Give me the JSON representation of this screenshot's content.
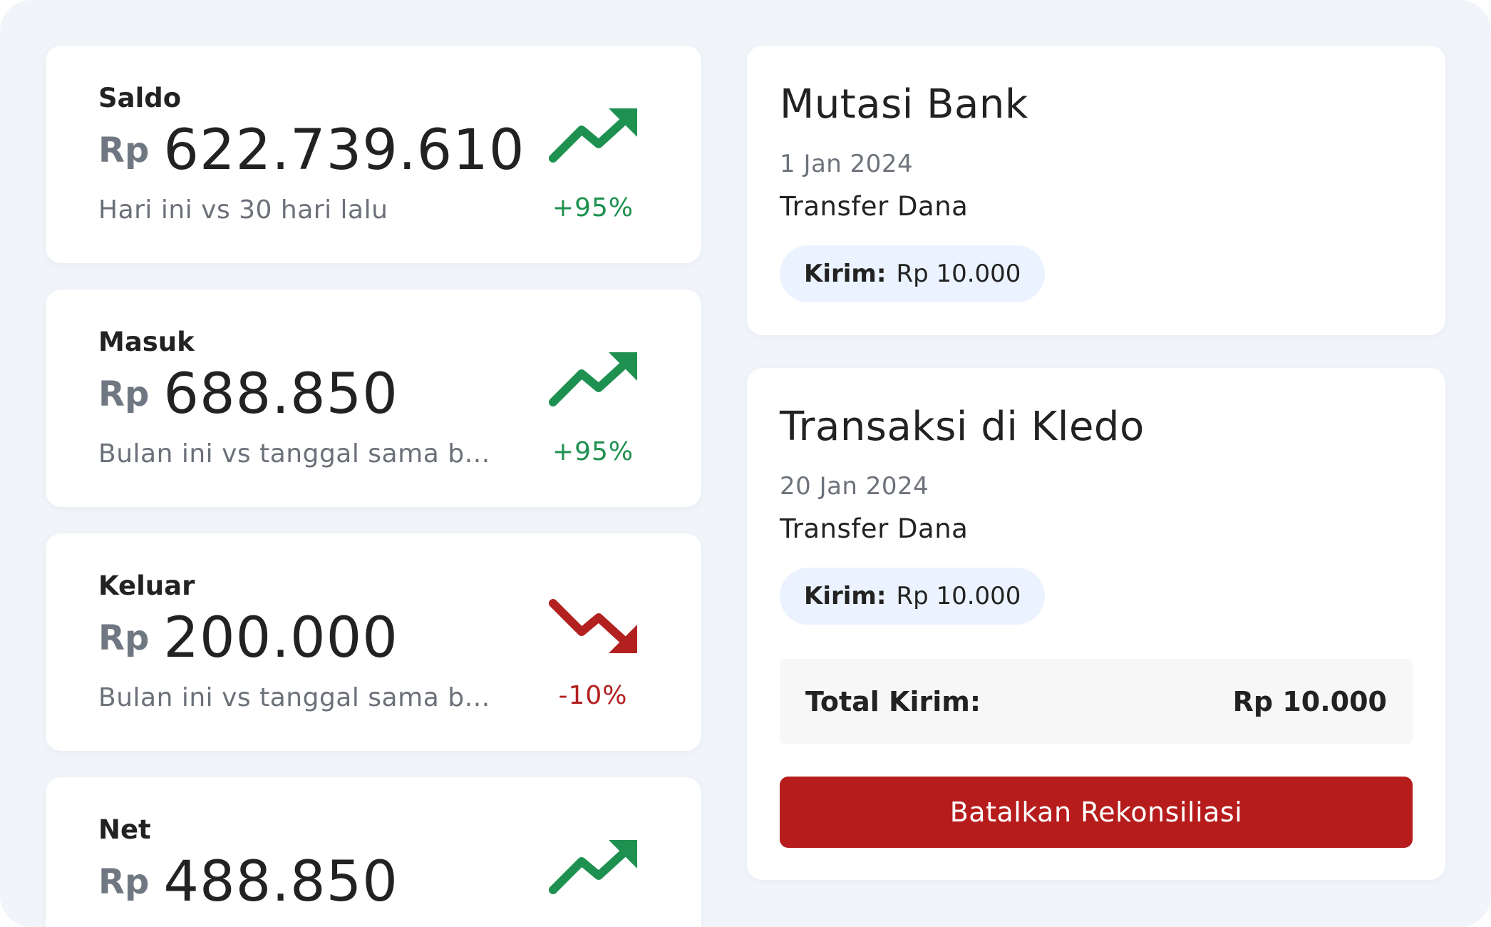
{
  "colors": {
    "background": "#f1f5fa",
    "positive": "#1e9150",
    "negative": "#b32020",
    "button": "#b71c1c",
    "pill": "#eaf3ff"
  },
  "stats": [
    {
      "title": "Saldo",
      "currency": "Rp",
      "amount": "622.739.610",
      "subtitle": "Hari ini vs 30 hari lalu",
      "change": "+95%",
      "trend_icon": "trend-up-icon"
    },
    {
      "title": "Masuk",
      "currency": "Rp",
      "amount": "688.850",
      "subtitle": "Bulan ini vs tanggal sama bulan lalu",
      "change": "+95%",
      "trend_icon": "trend-up-icon"
    },
    {
      "title": "Keluar",
      "currency": "Rp",
      "amount": "200.000",
      "subtitle": "Bulan ini vs tanggal sama bulan lalu",
      "change": "-10%",
      "trend_icon": "trend-down-icon"
    },
    {
      "title": "Net",
      "currency": "Rp",
      "amount": "488.850",
      "subtitle": "",
      "change": "",
      "trend_icon": "trend-up-icon"
    }
  ],
  "bank": {
    "title": "Mutasi Bank",
    "date": "1 Jan 2024",
    "description": "Transfer Dana",
    "pill_label": "Kirim:",
    "pill_value": "Rp 10.000"
  },
  "kledo": {
    "title": "Transaksi di Kledo",
    "date": "20 Jan 2024",
    "description": "Transfer Dana",
    "pill_label": "Kirim:",
    "pill_value": "Rp 10.000",
    "total_label": "Total Kirim:",
    "total_value": "Rp 10.000",
    "button_label": "Batalkan Rekonsiliasi"
  }
}
